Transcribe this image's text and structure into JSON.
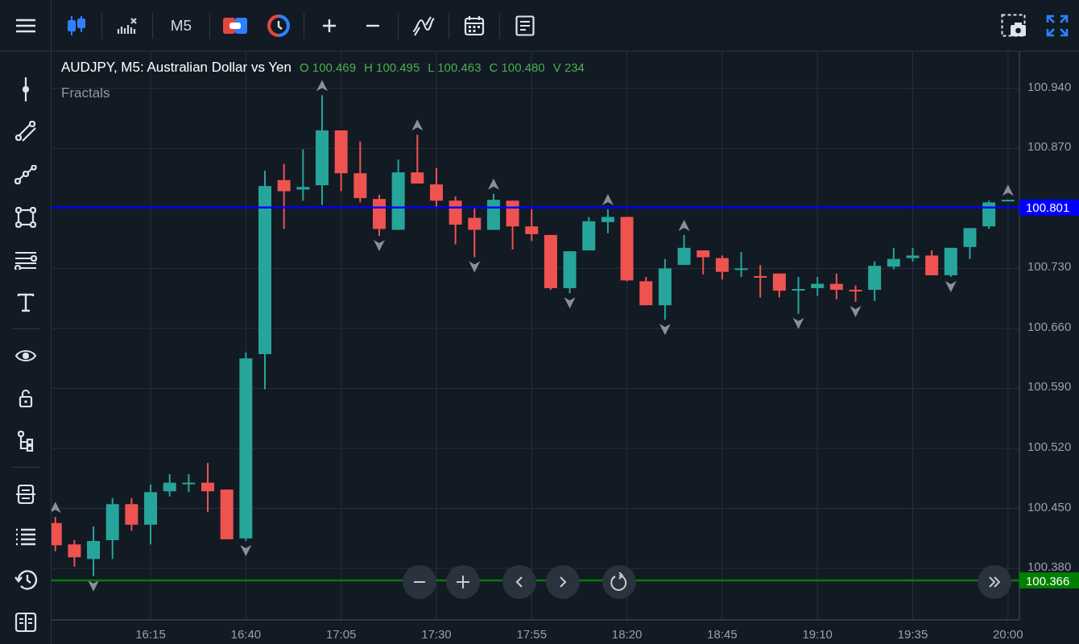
{
  "toolbar": {
    "timeframe": "M5"
  },
  "legend": {
    "title": "AUDJPY, M5: Australian Dollar vs Yen",
    "ohlcv": [
      "O 100.469",
      "H 100.495",
      "L 100.463",
      "C 100.480",
      "V 234"
    ],
    "indicator": "Fractals"
  },
  "chart": {
    "chart_data": {
      "type": "candlestick",
      "grid": true,
      "ylim": [
        100.32,
        100.983
      ],
      "xlim": [
        949,
        1203
      ],
      "x": [
        950,
        955,
        960,
        965,
        970,
        975,
        980,
        985,
        990,
        995,
        1000,
        1005,
        1010,
        1015,
        1020,
        1025,
        1030,
        1035,
        1040,
        1045,
        1050,
        1055,
        1060,
        1065,
        1070,
        1075,
        1080,
        1085,
        1090,
        1095,
        1100,
        1105,
        1110,
        1115,
        1120,
        1125,
        1130,
        1135,
        1140,
        1145,
        1150,
        1155,
        1160,
        1165,
        1170,
        1175,
        1180,
        1185,
        1190,
        1195,
        1200
      ],
      "yticks": [
        {
          "value": 100.94,
          "label": "100.940"
        },
        {
          "value": 100.87,
          "label": "100.870"
        },
        {
          "value": 100.73,
          "label": "100.730"
        },
        {
          "value": 100.66,
          "label": "100.660"
        },
        {
          "value": 100.59,
          "label": "100.590"
        },
        {
          "value": 100.52,
          "label": "100.520"
        },
        {
          "value": 100.45,
          "label": "100.450"
        },
        {
          "value": 100.38,
          "label": "100.380"
        }
      ],
      "xticks": [
        {
          "value": 975,
          "label": "16:15"
        },
        {
          "value": 1000,
          "label": "16:40"
        },
        {
          "value": 1025,
          "label": "17:05"
        },
        {
          "value": 1050,
          "label": "17:30"
        },
        {
          "value": 1075,
          "label": "17:55"
        },
        {
          "value": 1100,
          "label": "18:20"
        },
        {
          "value": 1125,
          "label": "18:45"
        },
        {
          "value": 1150,
          "label": "19:10"
        },
        {
          "value": 1175,
          "label": "19:35"
        },
        {
          "value": 1200,
          "label": "20:00"
        }
      ],
      "ohlc": [
        [
          100.433,
          100.44,
          100.4,
          100.407
        ],
        [
          100.408,
          100.413,
          100.382,
          100.393
        ],
        [
          100.391,
          100.429,
          100.371,
          100.412
        ],
        [
          100.413,
          100.462,
          100.391,
          100.455
        ],
        [
          100.455,
          100.462,
          100.424,
          100.431
        ],
        [
          100.431,
          100.478,
          100.408,
          100.469
        ],
        [
          100.47,
          100.49,
          100.464,
          100.48
        ],
        [
          100.479,
          100.49,
          100.469,
          100.48
        ],
        [
          100.48,
          100.503,
          100.446,
          100.47
        ],
        [
          100.472,
          100.472,
          100.414,
          100.414
        ],
        [
          100.415,
          100.632,
          100.412,
          100.625
        ],
        [
          100.63,
          100.844,
          100.589,
          100.826
        ],
        [
          100.833,
          100.852,
          100.776,
          100.82
        ],
        [
          100.822,
          100.869,
          100.809,
          100.825
        ],
        [
          100.827,
          100.932,
          100.804,
          100.891
        ],
        [
          100.891,
          100.891,
          100.82,
          100.841
        ],
        [
          100.841,
          100.878,
          100.807,
          100.812
        ],
        [
          100.811,
          100.816,
          100.768,
          100.776
        ],
        [
          100.775,
          100.857,
          100.775,
          100.842
        ],
        [
          100.842,
          100.886,
          100.829,
          100.829
        ],
        [
          100.828,
          100.847,
          100.801,
          100.809
        ],
        [
          100.809,
          100.814,
          100.758,
          100.781
        ],
        [
          100.789,
          100.801,
          100.743,
          100.775
        ],
        [
          100.775,
          100.817,
          100.775,
          100.81
        ],
        [
          100.809,
          100.809,
          100.752,
          100.779
        ],
        [
          100.779,
          100.799,
          100.762,
          100.77
        ],
        [
          100.769,
          100.769,
          100.705,
          100.707
        ],
        [
          100.707,
          100.75,
          100.701,
          100.75
        ],
        [
          100.751,
          100.79,
          100.751,
          100.785
        ],
        [
          100.784,
          100.799,
          100.771,
          100.79
        ],
        [
          100.79,
          100.79,
          100.715,
          100.716
        ],
        [
          100.715,
          100.72,
          100.687,
          100.687
        ],
        [
          100.687,
          100.741,
          100.67,
          100.73
        ],
        [
          100.734,
          100.769,
          100.734,
          100.754
        ],
        [
          100.751,
          100.751,
          100.723,
          100.743
        ],
        [
          100.742,
          100.745,
          100.717,
          100.726
        ],
        [
          100.729,
          100.749,
          100.72,
          100.73
        ],
        [
          100.721,
          100.734,
          100.696,
          100.72
        ],
        [
          100.724,
          100.724,
          100.696,
          100.704
        ],
        [
          100.705,
          100.72,
          100.677,
          100.706
        ],
        [
          100.707,
          100.72,
          100.698,
          100.712
        ],
        [
          100.712,
          100.724,
          100.694,
          100.705
        ],
        [
          100.705,
          100.71,
          100.691,
          100.704
        ],
        [
          100.705,
          100.738,
          100.692,
          100.733
        ],
        [
          100.732,
          100.754,
          100.729,
          100.741
        ],
        [
          100.742,
          100.754,
          100.738,
          100.745
        ],
        [
          100.745,
          100.751,
          100.722,
          100.722
        ],
        [
          100.722,
          100.754,
          100.72,
          100.754
        ],
        [
          100.755,
          100.777,
          100.741,
          100.777
        ],
        [
          100.779,
          100.809,
          100.776,
          100.807
        ],
        [
          100.809,
          100.81,
          100.809,
          100.81
        ]
      ],
      "ref_lines": [
        {
          "axis": "y",
          "value": 100.801,
          "label": "100.801",
          "color": "#0000ff"
        },
        {
          "axis": "y",
          "value": 100.366,
          "label": "100.366",
          "color": "#008000"
        }
      ]
    }
  }
}
